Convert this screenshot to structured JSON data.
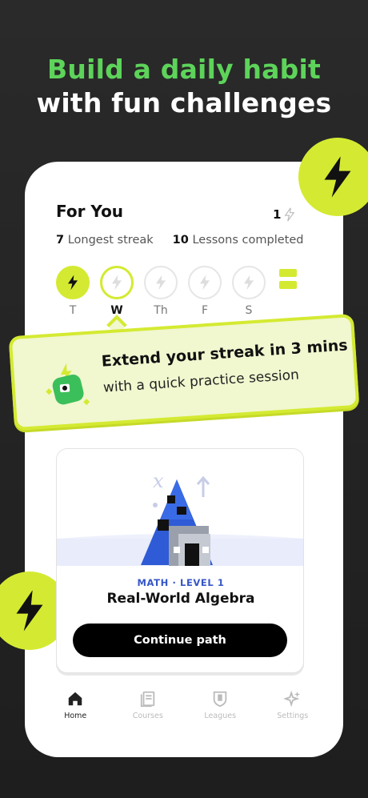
{
  "headline": {
    "line1": "Build a daily habit",
    "line2": "with fun challenges"
  },
  "header": {
    "title": "For You",
    "streak_count": "1"
  },
  "stats": {
    "longest_streak_value": "7",
    "longest_streak_label": "Longest streak",
    "lessons_value": "10",
    "lessons_label": "Lessons completed"
  },
  "week": [
    {
      "label": "T",
      "state": "done"
    },
    {
      "label": "W",
      "state": "today"
    },
    {
      "label": "Th",
      "state": "upcoming"
    },
    {
      "label": "F",
      "state": "upcoming"
    },
    {
      "label": "S",
      "state": "upcoming"
    }
  ],
  "banner": {
    "title": "Extend your streak in 3 mins",
    "subtitle": "with a quick practice session"
  },
  "course": {
    "kicker": "MATH · LEVEL 1",
    "title": "Real-World Algebra",
    "button": "Continue path"
  },
  "nav": [
    {
      "label": "Home",
      "icon": "home-icon",
      "active": true
    },
    {
      "label": "Courses",
      "icon": "courses-icon",
      "active": false
    },
    {
      "label": "Leagues",
      "icon": "leagues-icon",
      "active": false
    },
    {
      "label": "Settings",
      "icon": "settings-icon",
      "active": false
    }
  ],
  "colors": {
    "accent": "#d4ea32",
    "headline_green": "#5dd35a",
    "kicker_blue": "#3556c8"
  }
}
